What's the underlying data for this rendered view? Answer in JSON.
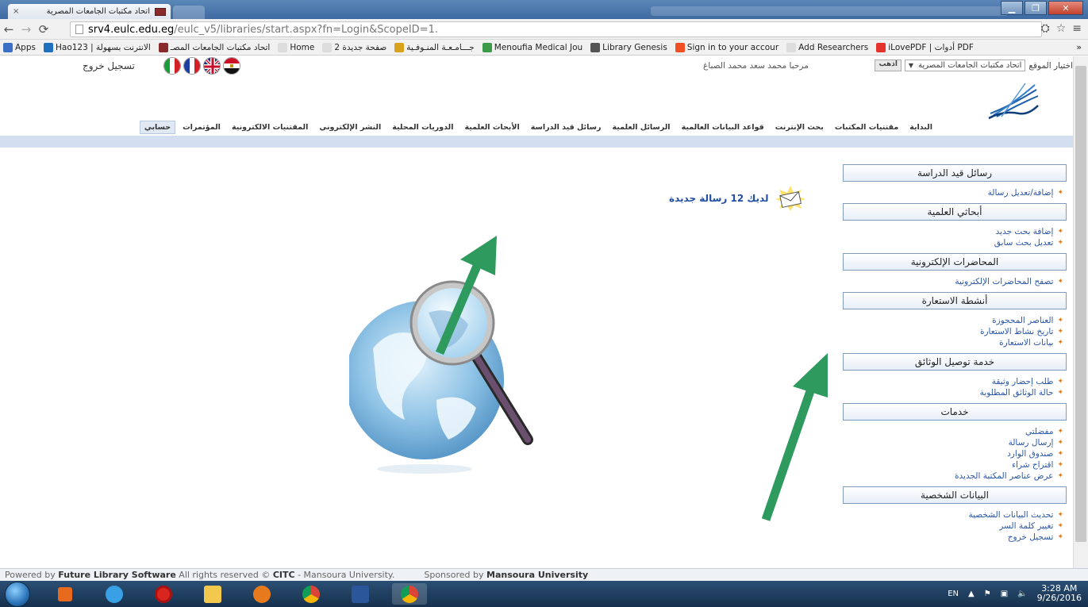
{
  "browser": {
    "tab_title": "اتحاد مكتبات الجامعات المصرية",
    "tab_close": "×",
    "url_host": "srv4.eulc.edu.eg",
    "url_path": "/eulc_v5/libraries/start.aspx?fn=Login&ScopeID=1.",
    "window_controls": {
      "minimize": "▁",
      "maximize": "❐",
      "close": "✕"
    },
    "bookmarks": [
      {
        "label": "Apps",
        "color": "#3b6fc4"
      },
      {
        "label": "Hao123 | الانترنت بسهولة",
        "color": "#1f6fbf"
      },
      {
        "label": "اتحاد مكتبات الجامعات المصـ",
        "color": "#8a2b2b"
      },
      {
        "label": "Home",
        "color": "#dddddd"
      },
      {
        "label": "صفحة جديدة 2",
        "color": "#dddddd"
      },
      {
        "label": "جـــامـعـة المنـوفـية",
        "color": "#d9a21b"
      },
      {
        "label": "Menoufia Medical Jou",
        "color": "#3a9a4a"
      },
      {
        "label": "Library Genesis",
        "color": "#555555"
      },
      {
        "label": "Sign in to your accour",
        "color": "#f25022"
      },
      {
        "label": "Add Researchers",
        "color": "#dddddd"
      },
      {
        "label": "iLovePDF | أدوات PDF",
        "color": "#e5322d"
      }
    ],
    "bookmarks_more": "»"
  },
  "header": {
    "site_select_label": "اختيار الموقع",
    "site_select_value": "اتحاد مكتبات الجامعات المصرية",
    "go_label": "اذهب",
    "welcome": "مرحبا  محمد سعد محمد الصباغ",
    "logout": "تسجيل خروج"
  },
  "nav": [
    {
      "label": "البداية",
      "active": false
    },
    {
      "label": "مقتنيات المكتبات",
      "active": false
    },
    {
      "label": "بحث الإنترنت",
      "active": false
    },
    {
      "label": "قواعد البيانات العالمية",
      "active": false
    },
    {
      "label": "الرسائل العلمية",
      "active": false
    },
    {
      "label": "رسائل قيد الدراسة",
      "active": false
    },
    {
      "label": "الأبحاث العلمية",
      "active": false
    },
    {
      "label": "الدوريات المحلية",
      "active": false
    },
    {
      "label": "النشر الإلكتروني",
      "active": false
    },
    {
      "label": "المقتنيات الالكترونية",
      "active": false
    },
    {
      "label": "المؤتمرات",
      "active": false
    },
    {
      "label": "حسابي",
      "active": true
    }
  ],
  "sidebar": [
    {
      "title": "رسائل قيد الدراسة",
      "items": [
        "إضافة/تعديل رسالة"
      ]
    },
    {
      "title": "أبحاثي العلمية",
      "items": [
        "إضافة بحث جديد",
        "تعديل بحث سابق"
      ]
    },
    {
      "title": "المحاضرات الإلكترونية",
      "items": [
        "تصفح المحاضرات الإلكترونية"
      ]
    },
    {
      "title": "أنشطة الاستعارة",
      "items": [
        "العناصر المحجوزة",
        "تاريخ نشاط الاستعارة",
        "بيانات الاستعارة"
      ]
    },
    {
      "title": "خدمة توصيل الوثائق",
      "items": [
        "طلب إحضار وثيقة",
        "حالة الوثائق المطلوبة"
      ]
    },
    {
      "title": "خدمات",
      "items": [
        "مفضلتي",
        "إرسال رسالة",
        "صندوق الوارد",
        "اقتراح شراء",
        "عرض عناصر المكتبة الجديدة"
      ]
    },
    {
      "title": "البيانات الشخصية",
      "items": [
        "تحديث البيانات الشخصية",
        "تغيير كلمة السر",
        "تسجيل خروج"
      ]
    }
  ],
  "content": {
    "new_messages": "لديك 12 رسالة جديدة"
  },
  "status": {
    "prefix": "Powered by ",
    "software": "Future Library Software",
    "rights": " All rights reserved © ",
    "org": "CITC",
    "location": " - Mansoura University.",
    "sponsor_prefix": "Sponsored by ",
    "sponsor": "Mansoura University"
  },
  "taskbar": {
    "lang": "EN",
    "time": "3:28 AM",
    "date": "9/26/2016"
  },
  "colors": {
    "accent_link": "#2a56a8",
    "arrow_green": "#2e9a5e",
    "nav_bar": "#d3dff0"
  }
}
